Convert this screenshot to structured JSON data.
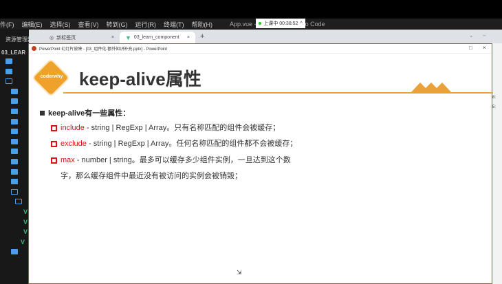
{
  "vscode": {
    "menu": [
      "件(F)",
      "编辑(E)",
      "选择(S)",
      "查看(V)",
      "转到(G)",
      "运行(R)",
      "终端(T)",
      "帮助(H)"
    ],
    "window_title": "App.vue - 03_le… ual Studio Code",
    "explorer_title": "资源管理器",
    "project": "03_LEAR",
    "right_text": [
      "8:",
      "5:"
    ]
  },
  "recording": {
    "label": "上课中 00:38:52",
    "chevron": "^"
  },
  "browser": {
    "tabs": [
      {
        "label": "新标签页",
        "close": "×"
      },
      {
        "label": "03_learn_component",
        "close": "×"
      }
    ],
    "new_tab": "+"
  },
  "ppt": {
    "title": "PowerPoint 幻灯片放映 - [03_组件化-额外知识补充.pptx] - PowerPoint",
    "logo_text": "coderwhy",
    "slide_title": "keep-alive属性",
    "main_bullet": "keep-alive有一些属性：",
    "items": [
      {
        "keyword": "include",
        "text": " - string | RegExp | Array。只有名称匹配的组件会被缓存；"
      },
      {
        "keyword": "exclude",
        "text": " - string | RegExp | Array。任何名称匹配的组件都不会被缓存；"
      },
      {
        "keyword": "max",
        "text": " - number | string。最多可以缓存多少组件实例，一旦达到这个数",
        "cont": "字，那么缓存组件中最近没有被访问的实例会被销毁；"
      }
    ],
    "accent": "#e9a13a",
    "keyword_color": "#e01010"
  }
}
